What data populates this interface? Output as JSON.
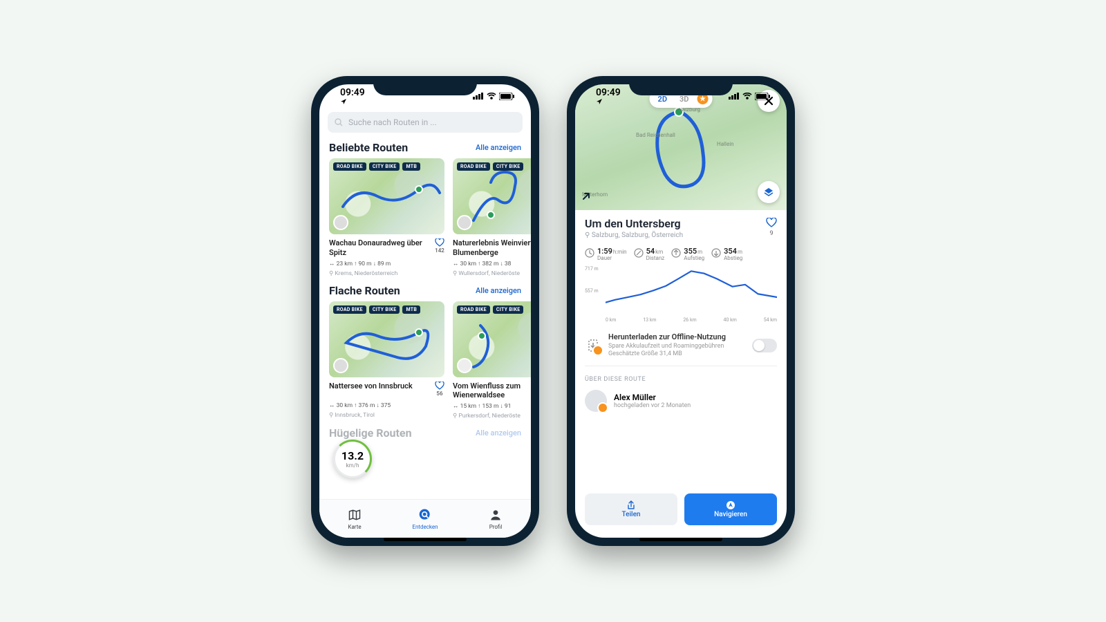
{
  "status": {
    "time": "09:49"
  },
  "search": {
    "placeholder": "Suche nach Routen in ..."
  },
  "sections": {
    "popular": {
      "title": "Beliebte Routen",
      "all": "Alle anzeigen"
    },
    "flat": {
      "title": "Flache Routen",
      "all": "Alle anzeigen"
    },
    "hilly": {
      "title": "Hügelige Routen",
      "all": "Alle anzeigen"
    }
  },
  "tags": {
    "road": "ROAD BIKE",
    "city": "CITY BIKE",
    "mtb": "MTB"
  },
  "routes": {
    "p1": {
      "title": "Wachau Donauradweg über Spitz",
      "fav": "142",
      "meta": "↔ 23 km  ↑ 90 m  ↓ 89 m",
      "loc": "Krems, Niederösterreich"
    },
    "p2": {
      "title": "Naturerlebnis Weinviertel Blumenberge",
      "meta": "↔ 30 km  ↑ 382 m  ↓ 38",
      "loc": "Wullersdorf, Niederöste"
    },
    "f1": {
      "title": "Nattersee von Innsbruck",
      "fav": "56",
      "meta": "↔ 30 km  ↑ 376 m  ↓ 375",
      "loc": "Innsbruck, Tirol"
    },
    "f2": {
      "title": "Vom Wienfluss zum Wienerwaldsee",
      "meta": "↔ 15 km  ↑ 153 m  ↓ 91",
      "loc": "Purkersdorf, Niederöste"
    }
  },
  "speed": {
    "value": "13.2",
    "unit": "km/h"
  },
  "tabs": {
    "map": "Karte",
    "discover": "Entdecken",
    "profile": "Profil"
  },
  "pill": {
    "d2": "2D",
    "d3": "3D"
  },
  "detail": {
    "title": "Um den Untersberg",
    "loc": "Salzburg, Salzburg, Österreich",
    "fav": "9",
    "stats": {
      "dur": {
        "v": "1:59",
        "u": "h:min",
        "l": "Dauer"
      },
      "dist": {
        "v": "54",
        "u": "km",
        "l": "Distanz"
      },
      "asc": {
        "v": "355",
        "u": "m",
        "l": "Aufstieg"
      },
      "desc": {
        "v": "354",
        "u": "m",
        "l": "Abstieg"
      }
    },
    "offline": {
      "t": "Herunterladen zur Offline-Nutzung",
      "s": "Spare Akkulaufzeit und Roaminggebühren\nGeschätzte Größe 31,4 MB"
    },
    "about": "ÜBER DIESE ROUTE",
    "author": {
      "name": "Alex Müller",
      "sub": "hochgeladen vor 2 Monaten"
    },
    "share": "Teilen",
    "nav": "Navigieren"
  },
  "chart_data": {
    "type": "line",
    "title": "",
    "xlabel": "km",
    "ylabel": "m",
    "ylim": [
      400,
      750
    ],
    "xlim": [
      0,
      54
    ],
    "y_ticks": [
      "717 m",
      "557 m"
    ],
    "x_ticks": [
      "0 km",
      "13 km",
      "26 km",
      "40 km",
      "54 km"
    ],
    "x": [
      0,
      3,
      7,
      11,
      15,
      19,
      23,
      27,
      31,
      35,
      40,
      44,
      48,
      54
    ],
    "values": [
      480,
      500,
      520,
      540,
      570,
      605,
      660,
      717,
      700,
      660,
      600,
      615,
      545,
      520
    ]
  },
  "map_labels": {
    "salzburg": "Salzburg",
    "hallein": "Hallein",
    "reich": "Bad Reichenhall",
    "mitt": "Mitterhorn"
  }
}
